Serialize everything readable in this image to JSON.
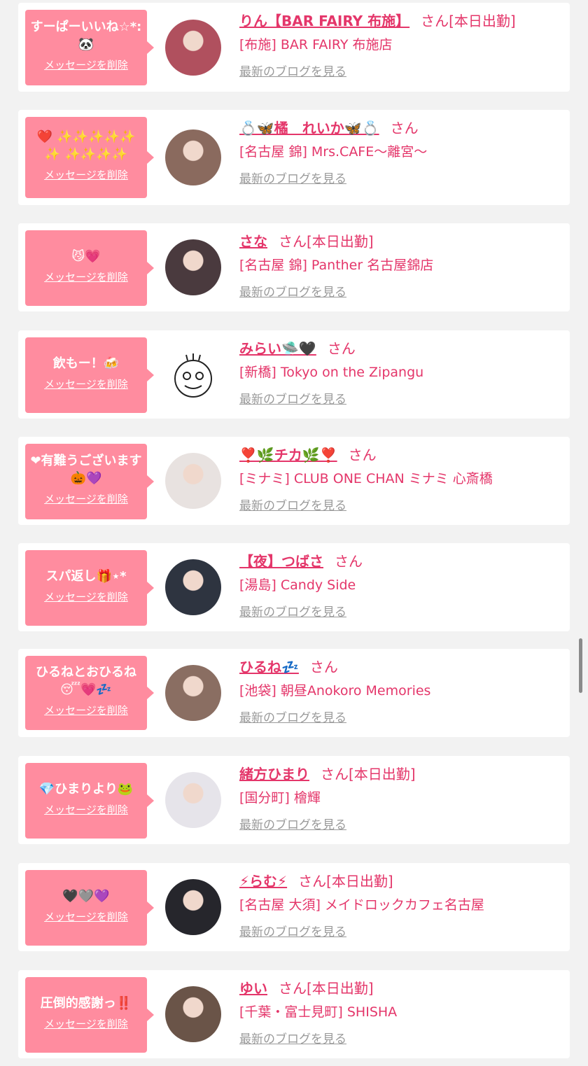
{
  "list": {
    "delete_label": "メッセージを削除",
    "blog_label": "最新のブログを見る",
    "items": [
      {
        "message": "すーぱーいいね☆*: 🐼",
        "name": "りん【BAR FAIRY 布施】",
        "suffix": "さん[本日出勤]",
        "shop": "[布施] BAR FAIRY 布施店",
        "avatar_color": "#b0505e"
      },
      {
        "message": "❤️ ✨✨✨✨✨✨ ✨✨✨✨",
        "name": "💍🦋橘　れいか🦋💍",
        "suffix": "さん",
        "shop": "[名古屋 錦] Mrs.CAFE〜離宮〜",
        "avatar_color": "#8a6a5e"
      },
      {
        "message": "😼💗",
        "name": "さな",
        "suffix": "さん[本日出勤]",
        "shop": "[名古屋 錦] Panther 名古屋錦店",
        "avatar_color": "#4a3a3e"
      },
      {
        "message": "飲もー！🍻",
        "name": "みらい🛸🖤",
        "suffix": "さん",
        "shop": "[新橋] Tokyo on the Zipangu",
        "avatar_color": "#ffffff"
      },
      {
        "message": "❤有難うございます🎃💜",
        "name": "❣️🌿チカ🌿❣️",
        "suffix": "さん",
        "shop": "[ミナミ] CLUB ONE CHAN ミナミ 心斎橋",
        "avatar_color": "#e8e2e0"
      },
      {
        "message": "スパ返し🎁⋆*",
        "name": "【夜】つばさ",
        "suffix": "さん",
        "shop": "[湯島] Candy Side",
        "avatar_color": "#2e3440"
      },
      {
        "message": "ひるねとおひるね😴💗💤",
        "name": "ひるね💤",
        "suffix": "さん",
        "shop": "[池袋] 朝昼Anokoro Memories",
        "avatar_color": "#8a6e62"
      },
      {
        "message": "💎ひまりより🐸",
        "name": "緒方ひまり",
        "suffix": "さん[本日出勤]",
        "shop": "[国分町] 檜輝",
        "avatar_color": "#e6e4ea"
      },
      {
        "message": "🖤🩶💜",
        "name": "⚡らむ⚡",
        "suffix": "さん[本日出勤]",
        "shop": "[名古屋 大須] メイドロックカフェ名古屋",
        "avatar_color": "#26262c"
      },
      {
        "message": "圧倒的感謝っ‼️",
        "name": "ゆい",
        "suffix": "さん[本日出勤]",
        "shop": "[千葉・富士見町] SHISHA",
        "avatar_color": "#6a5448"
      }
    ]
  }
}
